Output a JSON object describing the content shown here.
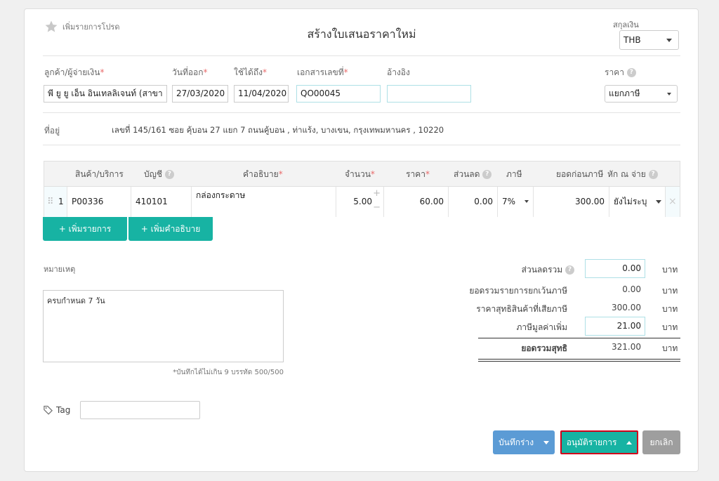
{
  "header": {
    "favorite_label": "เพิ่มรายการโปรด",
    "title": "สร้างใบเสนอราคาใหม่",
    "currency_label": "สกุลเงิน",
    "currency_value": "THB"
  },
  "fields": {
    "customer_label": "ลูกค้า/ผู้จ่ายเงิน",
    "customer_value": "พี ยู ยู เอ็น อินเทลลิเจนท์ (สาขา",
    "issue_date_label": "วันที่ออก",
    "issue_date_value": "27/03/2020",
    "valid_until_label": "ใช้ได้ถึง",
    "valid_until_value": "11/04/2020",
    "doc_no_label": "เอกสารเลขที่",
    "doc_no_value": "QO00045",
    "reference_label": "อ้างอิง",
    "reference_value": "",
    "price_label": "ราคา",
    "price_value": "แยกภาษี",
    "required_mark": "*"
  },
  "address": {
    "label": "ที่อยู่",
    "value": "เลขที่ 145/161 ซอย คุ้บอน 27 แยก 7 ถนนคู้บอน , ท่าแร้ง, บางเขน, กรุงเทพมหานคร , 10220"
  },
  "table": {
    "headers": {
      "product": "สินค้า/บริการ",
      "account": "บัญชี",
      "description": "คำอธิบาย",
      "quantity": "จำนวน",
      "price": "ราคา",
      "discount": "ส่วนลด",
      "tax": "ภาษี",
      "pretax": "ยอดก่อนภาษี",
      "withholding": "หัก ณ จ่าย"
    },
    "rows": [
      {
        "no": "1",
        "product": "P00336",
        "account": "410101",
        "description": "กล่องกระดาษ",
        "quantity": "5.00",
        "price": "60.00",
        "discount": "0.00",
        "tax": "7%",
        "pretax": "300.00",
        "withholding": "ยังไม่ระบุ"
      }
    ],
    "add_item_label": "+ เพิ่มรายการ",
    "add_desc_label": "+ เพิ่มคำอธิบาย"
  },
  "notes": {
    "label": "หมายเหตุ",
    "value": "ครบกำหนด 7 วัน",
    "hint": "*บันทึกได้ไม่เกิน 9 บรรทัด 500/500"
  },
  "summary": {
    "discount_label": "ส่วนลดรวม",
    "discount_value": "0.00",
    "exempt_label": "ยอดรวมรายการยกเว้นภาษี",
    "exempt_value": "0.00",
    "taxable_label": "ราคาสุทธิสินค้าที่เสียภาษี",
    "taxable_value": "300.00",
    "vat_label": "ภาษีมูลค่าเพิ่ม",
    "vat_value": "21.00",
    "total_label": "ยอดรวมสุทธิ",
    "total_value": "321.00",
    "unit": "บาท"
  },
  "tag": {
    "label": "Tag",
    "value": ""
  },
  "actions": {
    "save_draft": "บันทึกร่าง",
    "approve": "อนุมัติรายการ",
    "cancel": "ยกเลิก"
  },
  "colors": {
    "teal": "#17b3a3",
    "blue": "#5b9bd5",
    "gray": "#9e9e9e",
    "highlight": "#d0021b"
  }
}
